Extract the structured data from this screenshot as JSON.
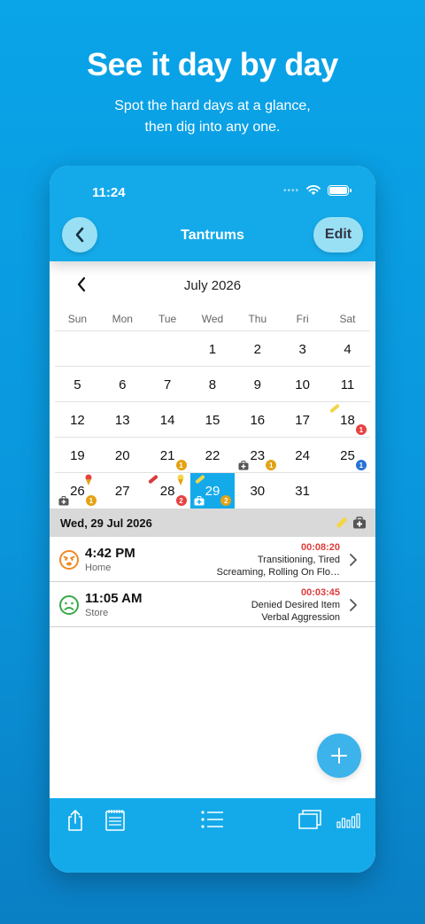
{
  "promo": {
    "headline": "See it day by day",
    "sub_line1": "Spot the hard days at a glance,",
    "sub_line2": "then dig into any one."
  },
  "status_bar": {
    "time": "11:24",
    "dots": "••••"
  },
  "nav": {
    "back_icon": "chevron-left-icon",
    "title": "Tantrums",
    "edit_label": "Edit"
  },
  "calendar": {
    "month_label": "July 2026",
    "weekdays": [
      "Sun",
      "Mon",
      "Tue",
      "Wed",
      "Thu",
      "Fri",
      "Sat"
    ],
    "weeks": [
      [
        "",
        "",
        "",
        "1",
        "2",
        "3",
        "4"
      ],
      [
        "5",
        "6",
        "7",
        "8",
        "9",
        "10",
        "11"
      ],
      [
        "12",
        "13",
        "14",
        "15",
        "16",
        "17",
        "18"
      ],
      [
        "19",
        "20",
        "21",
        "22",
        "23",
        "24",
        "25"
      ],
      [
        "26",
        "27",
        "28",
        "29",
        "30",
        "31",
        ""
      ]
    ],
    "selected_day": "29",
    "badges": {
      "18": {
        "count": "1",
        "color": "red"
      },
      "21": {
        "count": "1",
        "color": "gold"
      },
      "23": {
        "count": "1",
        "color": "gold"
      },
      "25": {
        "count": "1",
        "color": "blue"
      },
      "26": {
        "count": "1",
        "color": "gold"
      },
      "28": {
        "count": "2",
        "color": "red"
      },
      "29": {
        "count": "2",
        "color": "gold"
      }
    },
    "colors": {
      "red": "#e84040",
      "gold": "#e4a214",
      "blue": "#2a72d8",
      "accent": "#14aaea"
    }
  },
  "selected": {
    "header": "Wed, 29 Jul 2026",
    "icons": [
      "bandage-icon",
      "medical-bag-icon"
    ]
  },
  "entries": [
    {
      "time": "4:42 PM",
      "place": "Home",
      "duration": "00:08:20",
      "line1": "Transitioning, Tired",
      "line2": "Screaming, Rolling On Flo…",
      "face": "angry-face-icon",
      "face_color": "#f08a24"
    },
    {
      "time": "11:05 AM",
      "place": "Store",
      "duration": "00:03:45",
      "line1": "Denied Desired Item",
      "line2": "Verbal Aggression",
      "face": "sad-face-icon",
      "face_color": "#3aa84a"
    }
  ],
  "tabs": [
    "share-icon",
    "notebook-icon",
    "list-icon",
    "cards-icon",
    "bar-chart-icon"
  ]
}
